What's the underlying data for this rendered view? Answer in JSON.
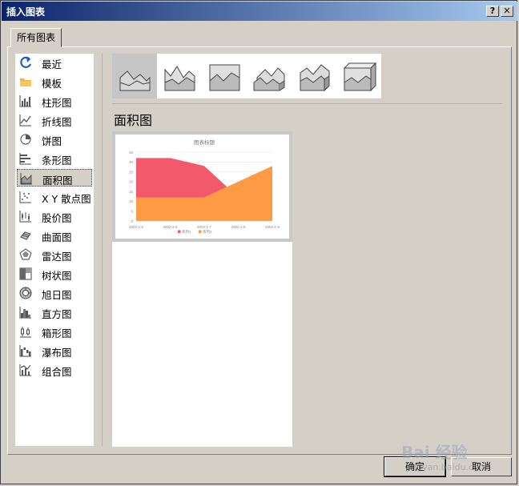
{
  "window": {
    "title": "插入图表",
    "help_label": "?",
    "close_label": "✕"
  },
  "tab": {
    "label": "所有图表"
  },
  "categories": [
    {
      "label": "最近",
      "icon": "recent-icon"
    },
    {
      "label": "模板",
      "icon": "folder-icon"
    },
    {
      "label": "柱形图",
      "icon": "column-chart-icon"
    },
    {
      "label": "折线图",
      "icon": "line-chart-icon"
    },
    {
      "label": "饼图",
      "icon": "pie-chart-icon"
    },
    {
      "label": "条形图",
      "icon": "bar-chart-icon"
    },
    {
      "label": "面积图",
      "icon": "area-chart-icon",
      "selected": true
    },
    {
      "label": "X Y 散点图",
      "icon": "scatter-chart-icon"
    },
    {
      "label": "股价图",
      "icon": "stock-chart-icon"
    },
    {
      "label": "曲面图",
      "icon": "surface-chart-icon"
    },
    {
      "label": "雷达图",
      "icon": "radar-chart-icon"
    },
    {
      "label": "树状图",
      "icon": "treemap-chart-icon"
    },
    {
      "label": "旭日图",
      "icon": "sunburst-chart-icon"
    },
    {
      "label": "直方图",
      "icon": "histogram-chart-icon"
    },
    {
      "label": "箱形图",
      "icon": "box-whisker-chart-icon"
    },
    {
      "label": "瀑布图",
      "icon": "waterfall-chart-icon"
    },
    {
      "label": "组合图",
      "icon": "combo-chart-icon"
    }
  ],
  "subtypes": [
    {
      "icon": "area-icon",
      "selected": true
    },
    {
      "icon": "stacked-area-icon"
    },
    {
      "icon": "percent-stacked-area-icon"
    },
    {
      "icon": "3d-area-icon"
    },
    {
      "icon": "3d-stacked-area-icon"
    },
    {
      "icon": "3d-percent-stacked-area-icon"
    }
  ],
  "section_title": "面积图",
  "chart_data": {
    "type": "area",
    "title": "图表标题",
    "x": [
      "2002-1-5",
      "2002-1-6",
      "2002-1-7",
      "2002-1-8",
      "2002-1-9"
    ],
    "series": [
      {
        "name": "系列1",
        "values": [
          32,
          32,
          28,
          12,
          15
        ],
        "color": "#f25a6b"
      },
      {
        "name": "系列2",
        "values": [
          12,
          12,
          12,
          20,
          28
        ],
        "color": "#ff9a45"
      }
    ],
    "ylim": [
      0,
      35
    ],
    "yticks": [
      0,
      5,
      10,
      15,
      20,
      25,
      30,
      35
    ],
    "grid": true,
    "legend_position": "bottom"
  },
  "buttons": {
    "ok": "确定",
    "cancel": "取消"
  },
  "watermark": {
    "brand": "Bai 经验",
    "sub": "jingyan.baidu.com"
  },
  "colors": {
    "titlebar_start": "#0a246a",
    "accent_icon": "#1f5fbf"
  }
}
